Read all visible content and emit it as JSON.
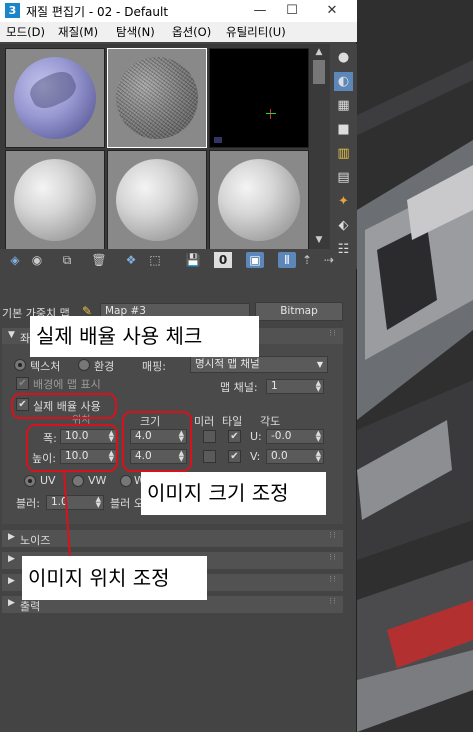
{
  "window": {
    "title": "재질 편집기 - 02 - Default",
    "app_icon": "3",
    "controls": [
      "—",
      "☐",
      "✕"
    ]
  },
  "menu": [
    "모드(D)",
    "재질(M)",
    "탐색(N)",
    "옵션(O)",
    "유틸리티(U)"
  ],
  "slots": {
    "items": [
      {
        "name": "slot-1",
        "kind": "purple-texture"
      },
      {
        "name": "slot-2",
        "kind": "noise"
      },
      {
        "name": "slot-3",
        "kind": "black"
      },
      {
        "name": "slot-4",
        "kind": "default"
      },
      {
        "name": "slot-5",
        "kind": "default"
      },
      {
        "name": "slot-6",
        "kind": "default"
      }
    ]
  },
  "toolbar": {
    "map_number_label": "0"
  },
  "map_row": {
    "label": "기본 가중치 맵",
    "map_name": "Map #3",
    "map_type": "Bitmap"
  },
  "coordinates": {
    "rollout_label": "좌",
    "texture_label": "텍스처",
    "environment_label": "환경",
    "mapping_label": "매핑:",
    "mapping_value": "명시적 맵 채널",
    "show_on_back_label": "배경에 맵 표시",
    "map_channel_label": "맵 채널:",
    "map_channel_value": "1",
    "real_world_label": "실제 배율 사용",
    "position_header": "위치",
    "size_header": "크기",
    "mirror_header": "미러",
    "tile_header": "타일",
    "angle_header": "각도",
    "width_label": "폭:",
    "width_value": "10.0",
    "height_label": "높이:",
    "height_value": "10.0",
    "size_u": "4.0",
    "size_v": "4.0",
    "u_label": "U:",
    "u_value": "-0.0",
    "v_label": "V:",
    "v_value": "0.0",
    "uv_label": "UV",
    "vw_label": "VW",
    "wu_label": "W",
    "blur_label": "블러:",
    "blur_value": "1.0",
    "blur_offset_label": "블러 오"
  },
  "rollouts": [
    {
      "label": "노이즈"
    },
    {
      "label": ""
    },
    {
      "label": ""
    },
    {
      "label": "출력"
    }
  ],
  "annotations": {
    "real_scale": "실제 배율 사용 체크",
    "size_adjust": "이미지 크기 조정",
    "position_adjust": "이미지 위치 조정",
    "color": "#d8121c"
  }
}
